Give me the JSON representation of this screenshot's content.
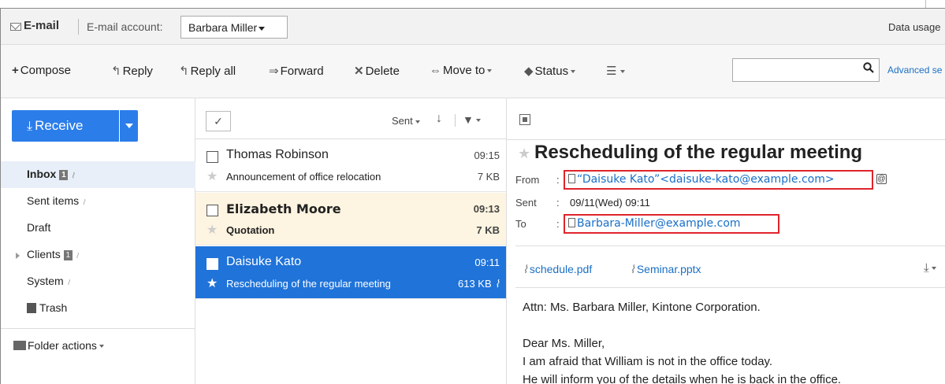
{
  "header": {
    "app_title": "E-mail",
    "account_label": "E-mail account:",
    "account_value": "Barbara Miller",
    "data_usage": "Data usage"
  },
  "toolbar": {
    "compose": "Compose",
    "reply": "Reply",
    "reply_all": "Reply all",
    "forward": "Forward",
    "delete": "Delete",
    "move_to": "Move to",
    "status": "Status",
    "search_placeholder": "",
    "advanced_search": "Advanced se"
  },
  "sidebar": {
    "receive": "Receive",
    "folders": [
      {
        "label": "Inbox",
        "badge": "1",
        "rss": true,
        "active": true
      },
      {
        "label": "Sent items",
        "badge": "",
        "rss": true,
        "active": false
      },
      {
        "label": "Draft",
        "badge": "",
        "rss": false,
        "active": false
      },
      {
        "label": "Clients",
        "badge": "1",
        "rss": true,
        "active": false,
        "expandable": true
      },
      {
        "label": "System",
        "badge": "",
        "rss": true,
        "active": false
      },
      {
        "label": "Trash",
        "badge": "",
        "rss": false,
        "active": false
      }
    ],
    "folder_actions": "Folder actions"
  },
  "list": {
    "select_all_glyph": "✓",
    "sort_label": "Sent",
    "messages": [
      {
        "sender": "Thomas Robinson",
        "time": "09:15",
        "subject": "Announcement of office relocation",
        "size": "7 KB",
        "state": "read"
      },
      {
        "sender": "Elizabeth Moore",
        "time": "09:13",
        "subject": "Quotation",
        "size": "7 KB",
        "state": "unread"
      },
      {
        "sender": "Daisuke Kato",
        "time": "09:11",
        "subject": "Rescheduling of the regular meeting",
        "size": "613 KB",
        "state": "selected",
        "attachment": true
      }
    ]
  },
  "reader": {
    "title": "Rescheduling of the regular meeting",
    "from_label": "From",
    "from_value": "“Daisuke Kato”<daisuke-kato@example.com>",
    "sent_label": "Sent",
    "sent_value": "09/11(Wed) 09:11",
    "to_label": "To",
    "to_value": "Barbara-Miller@example.com",
    "colon": ":",
    "attachments": [
      "schedule.pdf",
      "Seminar.pptx"
    ],
    "body": [
      "Attn: Ms. Barbara Miller, Kintone Corporation.",
      "Dear Ms. Miller,",
      "I am afraid that William is not in the office today.",
      "He will inform you of the details when he is back in the office."
    ]
  },
  "colors": {
    "accent": "#2b7de9",
    "selected_row": "#1f73d9",
    "unread_row": "#fdf4e1",
    "link": "#1a6fc6",
    "highlight_box": "#e0242b"
  }
}
